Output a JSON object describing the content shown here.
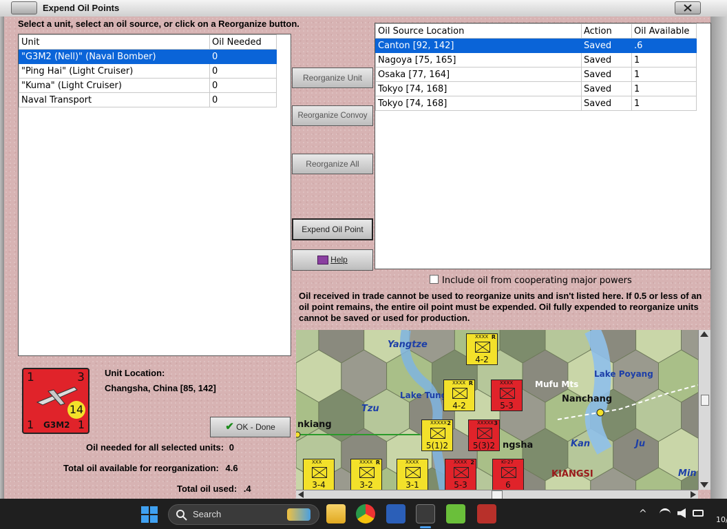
{
  "window": {
    "title": "Expend Oil Points"
  },
  "instruction": "Select a unit, select an oil source, or click on a Reorganize button.",
  "units_table": {
    "headers": [
      "Unit",
      "Oil Needed"
    ],
    "rows": [
      {
        "unit": "\"G3M2 (Nell)\" (Naval Bomber)",
        "oil": "0",
        "selected": true
      },
      {
        "unit": "\"Ping Hai\" (Light Cruiser)",
        "oil": "0",
        "selected": false
      },
      {
        "unit": "\"Kuma\" (Light Cruiser)",
        "oil": "0",
        "selected": false
      },
      {
        "unit": "Naval Transport",
        "oil": "0",
        "selected": false
      }
    ]
  },
  "sources_table": {
    "headers": [
      "Oil Source Location",
      "Action",
      "Oil Available"
    ],
    "rows": [
      {
        "location": "Canton [92, 142]",
        "action": "Saved",
        "available": ".6",
        "selected": true
      },
      {
        "location": "Nagoya [75, 165]",
        "action": "Saved",
        "available": "1",
        "selected": false
      },
      {
        "location": "Osaka [77, 164]",
        "action": "Saved",
        "available": "1",
        "selected": false
      },
      {
        "location": "Tokyo [74, 168]",
        "action": "Saved",
        "available": "1",
        "selected": false
      },
      {
        "location": "Tokyo [74, 168]",
        "action": "Saved",
        "available": "1",
        "selected": false
      }
    ]
  },
  "buttons": {
    "reorganize_unit": "Reorganize Unit",
    "reorganize_convoy": "Reorganize Convoy",
    "reorganize_all": "Reorganize All",
    "expend_oil_point": "Expend Oil Point",
    "help": "Help",
    "ok_done": "OK - Done"
  },
  "checkbox": {
    "label": "Include oil from cooperating major powers",
    "checked": false
  },
  "notice": "Oil received in trade cannot be used to reorganize units and isn't listed here.  If 0.5 or less of an oil point remains, the entire oil point must be expended.   Oil fully expended to reorganize units cannot be saved or used for production.",
  "unit_counter": {
    "top_left": "1",
    "top_right": "3",
    "bottom_left": "1",
    "bottom_right": "1",
    "badge": "14",
    "name": "G3M2"
  },
  "unit_location": {
    "label": "Unit Location:",
    "value": "Changsha, China [85, 142]"
  },
  "summary": {
    "needed_label": "Oil needed for all selected units:",
    "needed_value": "0",
    "available_label": "Total oil available for reorganization:",
    "available_value": "4.6",
    "used_label": "Total oil used:",
    "used_value": ".4"
  },
  "map": {
    "labels": [
      "Yangtze",
      "Lake Tung",
      "Tzu",
      "Mufu Mts",
      "Lake Poyang",
      "Nanchang",
      "Kan",
      "Ju",
      "KIANGSI",
      "Min",
      "nkiang",
      "ngsha"
    ],
    "counters": [
      {
        "top": "XXXX",
        "flag": "R",
        "value": "4-2",
        "color": "#f3e12a"
      },
      {
        "top": "XXXX",
        "flag": "R",
        "value": "4-2",
        "color": "#f3e12a"
      },
      {
        "top": "XXXX",
        "flag": "",
        "value": "5-3",
        "color": "#e0232a"
      },
      {
        "top": "XXXXX",
        "flag": "2",
        "value": "5(1)2",
        "color": "#f3e12a"
      },
      {
        "top": "XXXXX",
        "flag": "3",
        "value": "5(3)2",
        "color": "#e0232a"
      },
      {
        "top": "XXX",
        "flag": "",
        "value": "3-4",
        "color": "#f3e12a"
      },
      {
        "top": "XXXX",
        "flag": "R",
        "value": "3-2",
        "color": "#f3e12a"
      },
      {
        "top": "XXXX",
        "flag": "",
        "value": "3-1",
        "color": "#f3e12a"
      },
      {
        "top": "XXXX",
        "flag": "2",
        "value": "5-3",
        "color": "#e0232a"
      },
      {
        "top": "Ki-27",
        "flag": "",
        "value": "6",
        "color": "#e0232a"
      }
    ]
  },
  "taskbar": {
    "search_placeholder": "Search",
    "clock_fragment": "10/"
  }
}
